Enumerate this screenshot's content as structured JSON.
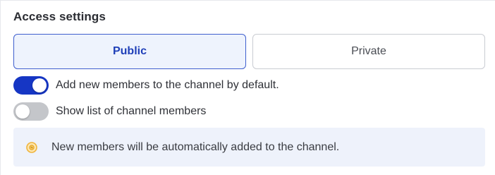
{
  "section": {
    "title": "Access settings"
  },
  "visibility": {
    "options": [
      {
        "label": "Public",
        "selected": true
      },
      {
        "label": "Private",
        "selected": false
      }
    ]
  },
  "toggles": [
    {
      "label": "Add new members to the channel by default.",
      "on": true
    },
    {
      "label": "Show list of channel members",
      "on": false
    }
  ],
  "info": {
    "icon": "lightbulb-icon",
    "text": "New members will be automatically added to the channel."
  },
  "colors": {
    "accent": "#1636c4",
    "selected_bg": "#eef3fd",
    "toggle_off": "#c4c6ca",
    "info_bg": "#eef2fb",
    "info_icon": "#f0b43c"
  }
}
